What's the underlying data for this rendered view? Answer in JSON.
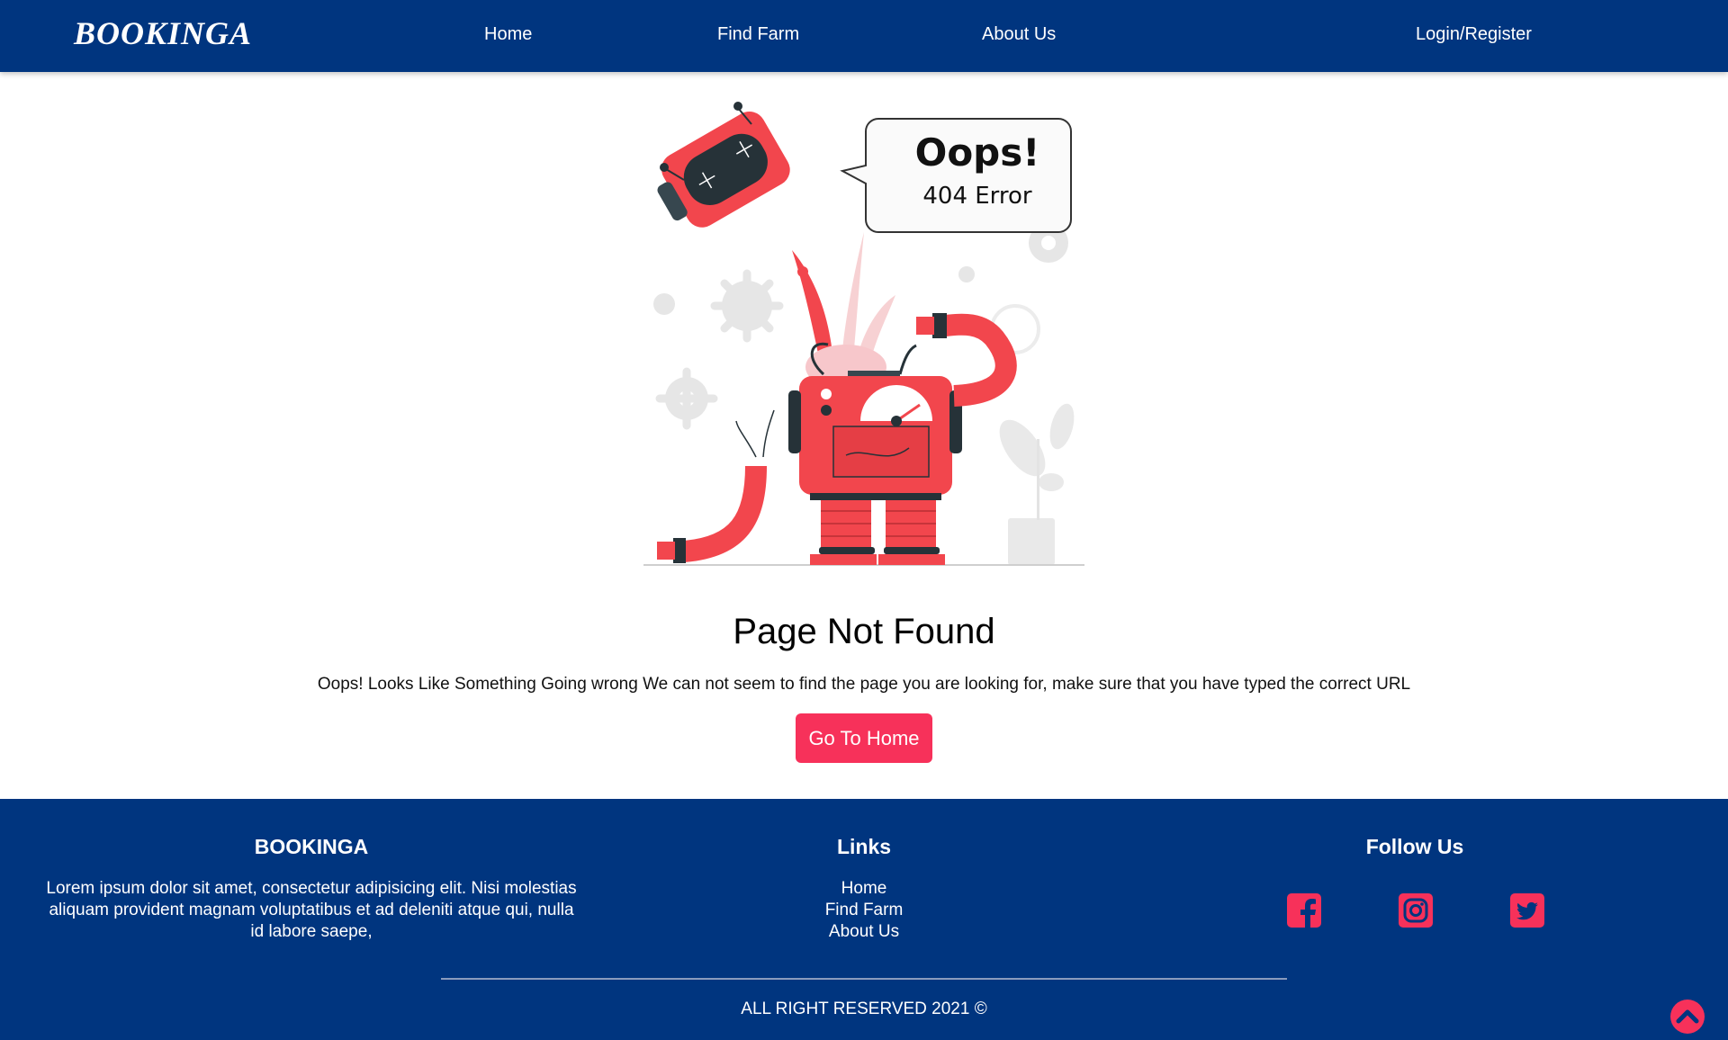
{
  "navbar": {
    "brand": "BOOKINGA",
    "links": [
      "Home",
      "Find Farm",
      "About Us"
    ],
    "login_label": "Login/Register"
  },
  "illustration": {
    "bubble_title": "Oops!",
    "bubble_subtitle": "404 Error"
  },
  "main": {
    "title": "Page Not Found",
    "message": "Oops! Looks Like Something Going wrong We can not seem to find the page you are looking for, make sure that you have typed the correct URL",
    "button_label": "Go To Home"
  },
  "footer": {
    "brand_title": "BOOKINGA",
    "brand_description": "Lorem ipsum dolor sit amet, consectetur adipisicing elit. Nisi molestias aliquam provident magnam voluptatibus et ad deleniti atque qui, nulla id labore saepe,",
    "links_title": "Links",
    "links": [
      "Home",
      "Find Farm",
      "About Us"
    ],
    "follow_title": "Follow Us",
    "social_icons": [
      "facebook-icon",
      "instagram-icon",
      "twitter-icon"
    ],
    "copyright": "ALL RIGHT RESERVED 2021 ©"
  },
  "colors": {
    "primary": "#00357f",
    "accent": "#f7315a",
    "robot": "#f2464d"
  }
}
